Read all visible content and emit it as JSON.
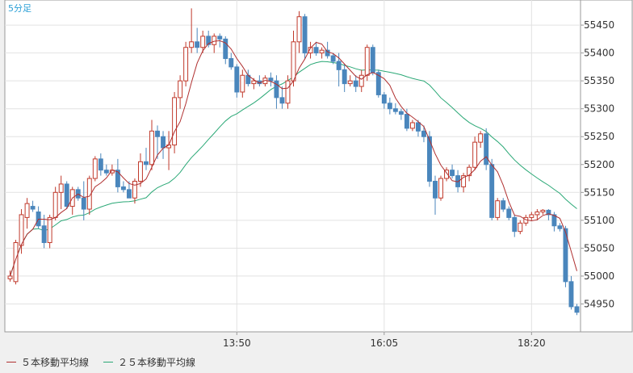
{
  "chart_data": {
    "type": "candlestick",
    "title": "5分足",
    "x_tick_labels": [
      "13:50",
      "16:05",
      "18:20"
    ],
    "y_ticks": [
      54950,
      55000,
      55050,
      55100,
      55150,
      55200,
      55250,
      55300,
      55350,
      55400,
      55450
    ],
    "ylim": [
      54900,
      55495
    ],
    "grid": true,
    "legend_position": "bottom-left",
    "colors": {
      "up": "#c0392b",
      "down": "#4a86bc",
      "ma5": "#b03030",
      "ma25": "#2aa876"
    },
    "ohlc": [
      [
        54995,
        55010,
        54990,
        55000
      ],
      [
        54990,
        55065,
        54985,
        55060
      ],
      [
        55055,
        55120,
        55040,
        55110
      ],
      [
        55105,
        55140,
        55085,
        55130
      ],
      [
        55125,
        55135,
        55115,
        55120
      ],
      [
        55115,
        55125,
        55085,
        55090
      ],
      [
        55090,
        55110,
        55050,
        55060
      ],
      [
        55060,
        55110,
        55050,
        55105
      ],
      [
        55105,
        55160,
        55100,
        55150
      ],
      [
        55150,
        55180,
        55120,
        55165
      ],
      [
        55165,
        55170,
        55120,
        55125
      ],
      [
        55125,
        55160,
        55110,
        55155
      ],
      [
        55155,
        55160,
        55135,
        55140
      ],
      [
        55140,
        55170,
        55100,
        55120
      ],
      [
        55120,
        55180,
        55110,
        55175
      ],
      [
        55175,
        55215,
        55170,
        55210
      ],
      [
        55210,
        55220,
        55180,
        55190
      ],
      [
        55190,
        55200,
        55180,
        55185
      ],
      [
        55185,
        55200,
        55180,
        55190
      ],
      [
        55190,
        55210,
        55150,
        55160
      ],
      [
        55160,
        55170,
        55150,
        55155
      ],
      [
        55155,
        55170,
        55140,
        55140
      ],
      [
        55140,
        55175,
        55130,
        55170
      ],
      [
        55170,
        55220,
        55160,
        55205
      ],
      [
        55205,
        55230,
        55190,
        55200
      ],
      [
        55200,
        55280,
        55190,
        55260
      ],
      [
        55260,
        55270,
        55210,
        55250
      ],
      [
        55250,
        55260,
        55210,
        55230
      ],
      [
        55230,
        55260,
        55190,
        55235
      ],
      [
        55235,
        55330,
        55220,
        55320
      ],
      [
        55320,
        55360,
        55300,
        55350
      ],
      [
        55350,
        55420,
        55340,
        55410
      ],
      [
        55410,
        55480,
        55400,
        55420
      ],
      [
        55420,
        55445,
        55400,
        55410
      ],
      [
        55410,
        55440,
        55400,
        55430
      ],
      [
        55430,
        55440,
        55410,
        55415
      ],
      [
        55415,
        55435,
        55400,
        55430
      ],
      [
        55430,
        55435,
        55410,
        55425
      ],
      [
        55425,
        55430,
        55380,
        55390
      ],
      [
        55390,
        55400,
        55370,
        55375
      ],
      [
        55375,
        55380,
        55320,
        55330
      ],
      [
        55330,
        55370,
        55320,
        55360
      ],
      [
        55360,
        55370,
        55340,
        55345
      ],
      [
        55345,
        55355,
        55335,
        55350
      ],
      [
        55350,
        55360,
        55340,
        55345
      ],
      [
        55345,
        55360,
        55340,
        55355
      ],
      [
        55355,
        55365,
        55340,
        55350
      ],
      [
        55350,
        55360,
        55300,
        55320
      ],
      [
        55320,
        55340,
        55300,
        55310
      ],
      [
        55310,
        55360,
        55300,
        55350
      ],
      [
        55350,
        55440,
        55340,
        55420
      ],
      [
        55420,
        55475,
        55400,
        55465
      ],
      [
        55465,
        55470,
        55390,
        55400
      ],
      [
        55400,
        55420,
        55390,
        55410
      ],
      [
        55410,
        55420,
        55395,
        55400
      ],
      [
        55400,
        55410,
        55390,
        55405
      ],
      [
        55405,
        55420,
        55390,
        55395
      ],
      [
        55395,
        55400,
        55380,
        55385
      ],
      [
        55385,
        55400,
        55340,
        55370
      ],
      [
        55370,
        55380,
        55330,
        55345
      ],
      [
        55345,
        55360,
        55340,
        55350
      ],
      [
        55350,
        55360,
        55330,
        55340
      ],
      [
        55340,
        55370,
        55330,
        55360
      ],
      [
        55360,
        55415,
        55350,
        55410
      ],
      [
        55410,
        55415,
        55360,
        55365
      ],
      [
        55365,
        55370,
        55320,
        55325
      ],
      [
        55325,
        55330,
        55300,
        55310
      ],
      [
        55310,
        55320,
        55290,
        55300
      ],
      [
        55300,
        55310,
        55290,
        55295
      ],
      [
        55295,
        55300,
        55280,
        55290
      ],
      [
        55290,
        55300,
        55260,
        55265
      ],
      [
        55265,
        55280,
        55260,
        55275
      ],
      [
        55275,
        55280,
        55250,
        55260
      ],
      [
        55260,
        55270,
        55240,
        55250
      ],
      [
        55250,
        55260,
        55160,
        55170
      ],
      [
        55170,
        55180,
        55110,
        55140
      ],
      [
        55140,
        55180,
        55135,
        55175
      ],
      [
        55175,
        55195,
        55170,
        55190
      ],
      [
        55190,
        55200,
        55175,
        55180
      ],
      [
        55180,
        55190,
        55150,
        55160
      ],
      [
        55160,
        55185,
        55150,
        55180
      ],
      [
        55180,
        55200,
        55170,
        55195
      ],
      [
        55195,
        55250,
        55190,
        55240
      ],
      [
        55240,
        55260,
        55230,
        55255
      ],
      [
        55255,
        55265,
        55190,
        55200
      ],
      [
        55200,
        55210,
        55100,
        55105
      ],
      [
        55105,
        55140,
        55100,
        55135
      ],
      [
        55135,
        55140,
        55115,
        55120
      ],
      [
        55120,
        55125,
        55100,
        55105
      ],
      [
        55105,
        55110,
        55070,
        55080
      ],
      [
        55080,
        55100,
        55075,
        55095
      ],
      [
        55095,
        55110,
        55090,
        55105
      ],
      [
        55105,
        55115,
        55100,
        55110
      ],
      [
        55110,
        55120,
        55100,
        55115
      ],
      [
        55115,
        55120,
        55110,
        55118
      ],
      [
        55118,
        55120,
        55100,
        55110
      ],
      [
        55110,
        55115,
        55080,
        55090
      ],
      [
        55090,
        55095,
        55080,
        55085
      ],
      [
        55085,
        55090,
        54980,
        54990
      ],
      [
        54990,
        55000,
        54940,
        54945
      ],
      [
        54945,
        54950,
        54930,
        54935
      ]
    ],
    "series": [
      {
        "name": "５本移動平均線",
        "indicator": "ma5"
      },
      {
        "name": "２５本移動平均線",
        "indicator": "ma25"
      }
    ]
  }
}
